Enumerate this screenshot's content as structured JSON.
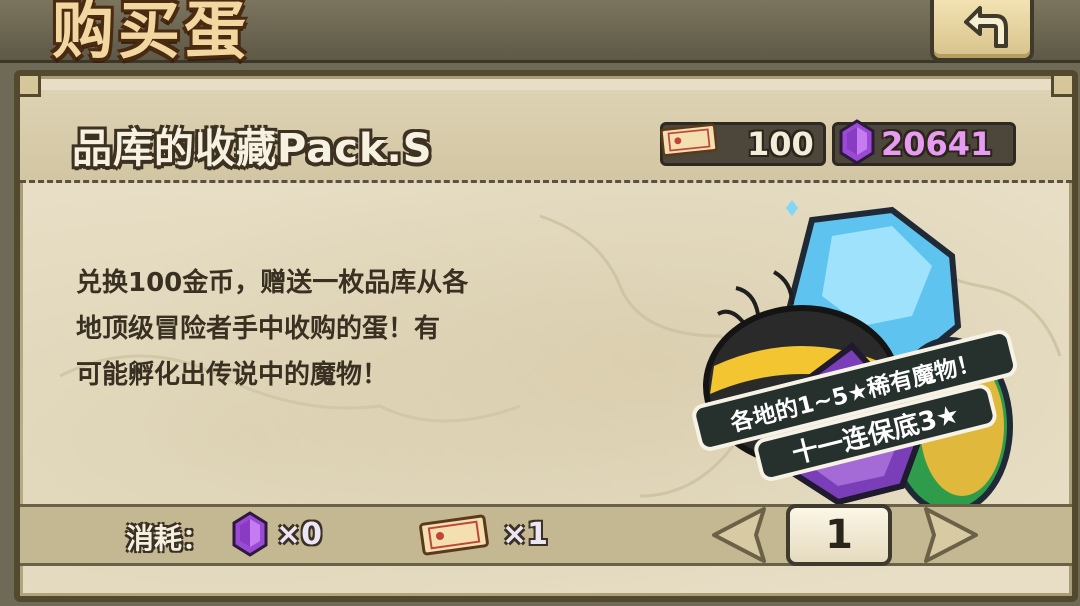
{
  "screen": {
    "title": "购买蛋"
  },
  "pack": {
    "name": "品库的收藏Pack.S",
    "description_lines": [
      "兑换100金币，赠送一枚品库从各",
      "地顶级冒险者手中收购的蛋！有",
      "可能孵化出传说中的魔物！"
    ]
  },
  "currency": {
    "tickets": "100",
    "gems": "20641"
  },
  "banner": {
    "line1": "各地的1~5★稀有魔物！",
    "line2": "十一连保底3★"
  },
  "cost": {
    "label": "消耗：",
    "gem_amount": "×0",
    "ticket_amount": "×1"
  },
  "quantity": {
    "value": "1"
  },
  "icons": {
    "back": "back-arrow-icon",
    "ticket": "ticket-icon",
    "gem": "purple-gem-icon",
    "left": "arrow-left-icon",
    "right": "arrow-right-icon"
  },
  "colors": {
    "gem_text": "#e79cf2",
    "ticket_text": "#f2ecd8",
    "parchment": "#e7dec5"
  }
}
